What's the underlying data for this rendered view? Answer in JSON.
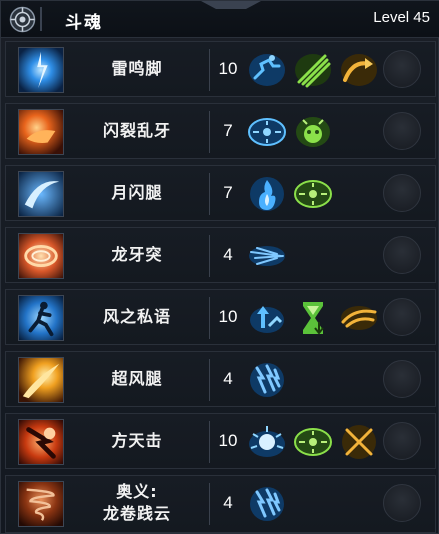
{
  "header": {
    "class_name": "斗魂",
    "level": "Level 45"
  },
  "skills": [
    {
      "name": "雷鸣脚",
      "level": "10",
      "buffs": [
        "sprint-icon",
        "claw-slash-icon",
        "arrow-curve-icon"
      ]
    },
    {
      "name": "闪裂乱牙",
      "level": "7",
      "buffs": [
        "knockdown-icon",
        "stun-face-icon"
      ]
    },
    {
      "name": "月闪腿",
      "level": "7",
      "buffs": [
        "flame-icon",
        "crosshair-icon"
      ]
    },
    {
      "name": "龙牙突",
      "level": "4",
      "buffs": [
        "dash-icon"
      ]
    },
    {
      "name": "风之私语",
      "level": "10",
      "buffs": [
        "stat-up-icon",
        "hourglass-down-icon",
        "wind-gust-icon"
      ]
    },
    {
      "name": "超风腿",
      "level": "4",
      "buffs": [
        "lightning-icon"
      ]
    },
    {
      "name": "方天击",
      "level": "10",
      "buffs": [
        "impact-burst-icon",
        "crosshair-icon",
        "cross-slash-icon"
      ]
    },
    {
      "name": "奥义:\n龙卷践云",
      "level": "4",
      "buffs": [
        "lightning-icon"
      ]
    }
  ],
  "colors": {
    "blue_skill": "#2f8fe8",
    "orange_skill": "#e8641c",
    "green_buff": "#5bc23a",
    "gold_buff": "#e7a628",
    "panel_bg": "#151a21"
  }
}
